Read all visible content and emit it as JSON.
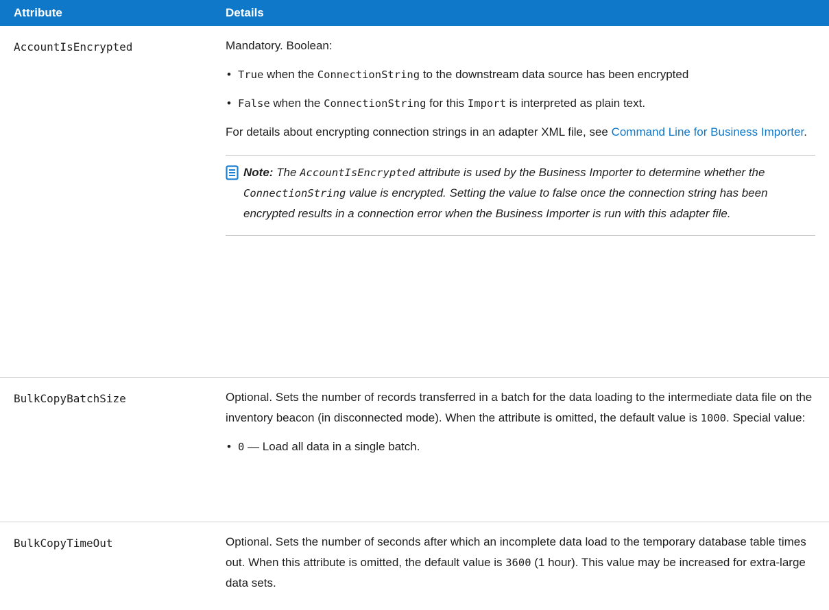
{
  "header": {
    "attribute": "Attribute",
    "details": "Details"
  },
  "rows": [
    {
      "name": "AccountIsEncrypted",
      "intro": "Mandatory. Boolean:",
      "bullets": [
        {
          "code1": "True",
          "t1": " when the ",
          "code2": "ConnectionString",
          "t2": " to the downstream data source has been encrypted"
        },
        {
          "code1": "False",
          "t1": " when the ",
          "code2": "ConnectionString",
          "t2": " for this ",
          "code3": "Import",
          "t3": " is interpreted as plain text."
        }
      ],
      "details_text": "For details about encrypting connection strings in an adapter XML file, see ",
      "details_link": "Command Line for Business Importer",
      "details_end": ".",
      "note": {
        "label": "Note:",
        "t1": " The ",
        "code1": "AccountIsEncrypted",
        "t2": " attribute is used by the Business Importer to determine whether the ",
        "code2": "ConnectionString",
        "t3": " value is encrypted. Setting the value to false once the connection string has been encrypted results in a connection error when the Business Importer is run with this adapter file."
      }
    },
    {
      "name": "BulkCopyBatchSize",
      "t1": "Optional. Sets the number of records transferred in a batch for the data loading to the intermediate data file on the inventory beacon (in disconnected mode). When the attribute is omitted, the default value is ",
      "code1": "1000",
      "t2": ". Special value:",
      "bullet_code": "0",
      "bullet_text": " — Load all data in a single batch."
    },
    {
      "name": "BulkCopyTimeOut",
      "t1": "Optional. Sets the number of seconds after which an incomplete data load to the temporary database table times out. When this attribute is omitted, the default value is ",
      "code1": "3600",
      "t2": " (1 hour). This value may be increased for extra-large data sets."
    }
  ],
  "icons": {
    "note": "note-document-icon",
    "bullet": "•"
  },
  "colors": {
    "header_bg": "#0f78c8",
    "link": "#0f78c8"
  }
}
